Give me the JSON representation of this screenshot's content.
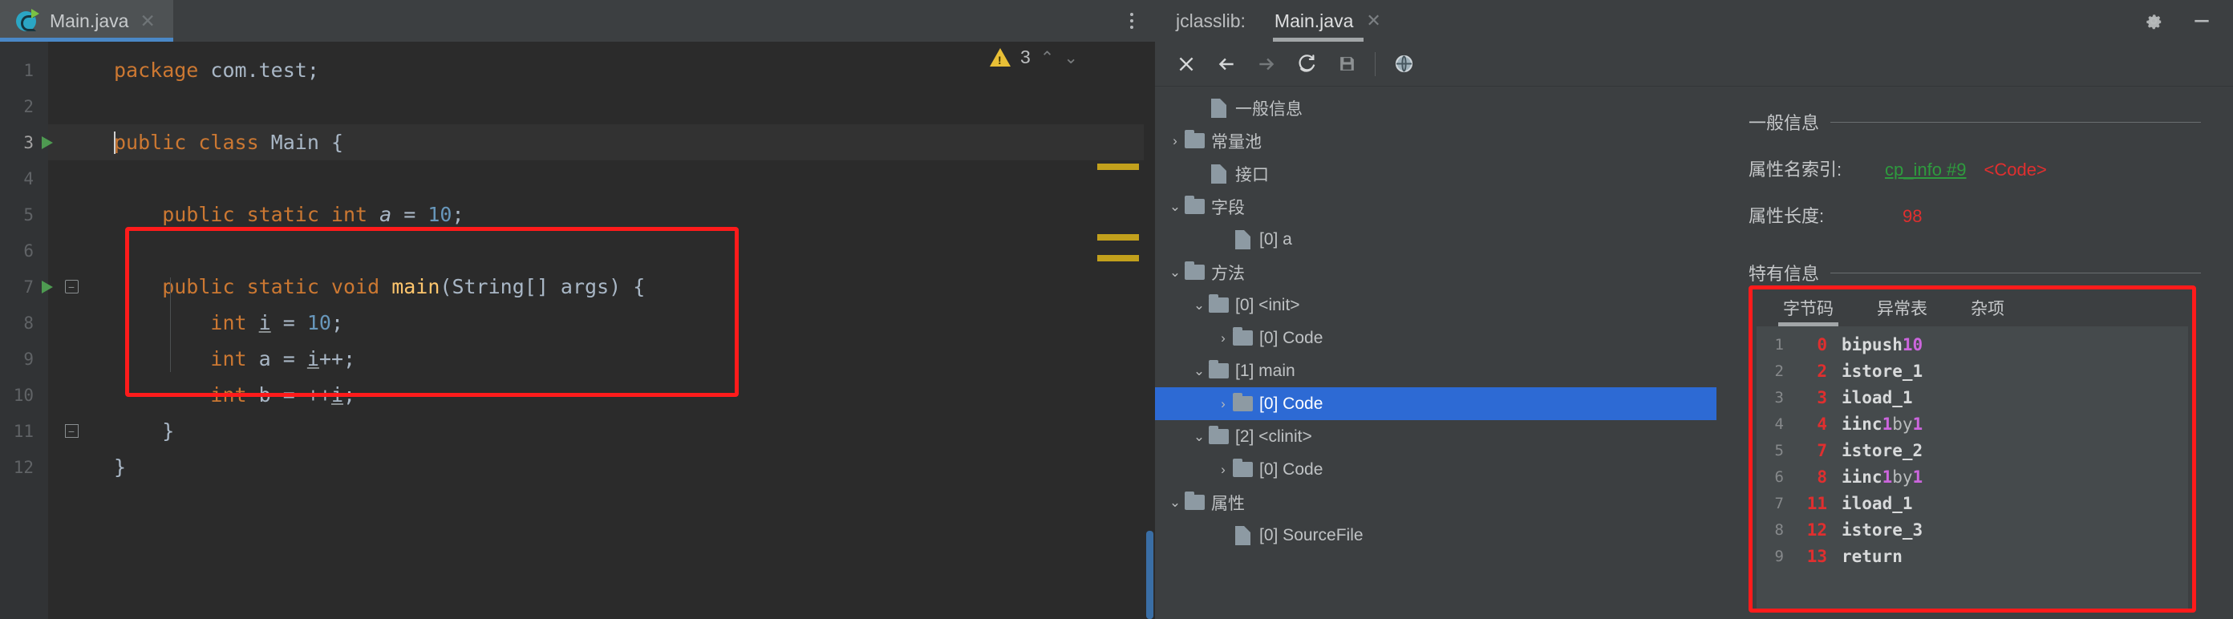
{
  "editor": {
    "tab": {
      "label": "Main.java",
      "icon": "java-class-icon",
      "close": "✕"
    },
    "more_menu": "more-options",
    "inspections": {
      "warning_count": "3",
      "prev": "⌃",
      "next": "⌄"
    },
    "lines": [
      {
        "no": "1",
        "segments": [
          {
            "t": "package ",
            "c": "kw"
          },
          {
            "t": "com.test;",
            "c": "plain"
          }
        ]
      },
      {
        "no": "2",
        "segments": []
      },
      {
        "no": "3",
        "segments": [
          {
            "t": "public class ",
            "c": "kw"
          },
          {
            "t": "Main",
            "c": "plain"
          },
          {
            "t": " {",
            "c": "plain"
          }
        ],
        "run": true,
        "current": true
      },
      {
        "no": "4",
        "segments": []
      },
      {
        "no": "5",
        "segments": [
          {
            "t": "    public static int ",
            "c": "kw"
          },
          {
            "t": "a",
            "c": "ital"
          },
          {
            "t": " = ",
            "c": "plain"
          },
          {
            "t": "10",
            "c": "num"
          },
          {
            "t": ";",
            "c": "plain"
          }
        ]
      },
      {
        "no": "6",
        "segments": []
      },
      {
        "no": "7",
        "segments": [
          {
            "t": "    public static void ",
            "c": "kw"
          },
          {
            "t": "main",
            "c": "fn"
          },
          {
            "t": "(String[] args) {",
            "c": "plain"
          }
        ],
        "run": true,
        "fold": "start"
      },
      {
        "no": "8",
        "segments": [
          {
            "t": "        ",
            "c": "plain"
          },
          {
            "t": "int ",
            "c": "kw"
          },
          {
            "t": "i",
            "c": "u"
          },
          {
            "t": " = ",
            "c": "plain"
          },
          {
            "t": "10",
            "c": "num"
          },
          {
            "t": ";",
            "c": "plain"
          }
        ]
      },
      {
        "no": "9",
        "segments": [
          {
            "t": "        ",
            "c": "plain"
          },
          {
            "t": "int ",
            "c": "kw"
          },
          {
            "t": "a",
            "c": "plain"
          },
          {
            "t": " = ",
            "c": "plain"
          },
          {
            "t": "i",
            "c": "u"
          },
          {
            "t": "++;",
            "c": "plain"
          }
        ]
      },
      {
        "no": "10",
        "segments": [
          {
            "t": "        ",
            "c": "plain"
          },
          {
            "t": "int ",
            "c": "kw"
          },
          {
            "t": "b",
            "c": "plain"
          },
          {
            "t": " = ++",
            "c": "plain"
          },
          {
            "t": "i",
            "c": "u"
          },
          {
            "t": ";",
            "c": "plain"
          }
        ]
      },
      {
        "no": "11",
        "segments": [
          {
            "t": "    }",
            "c": "plain"
          }
        ],
        "fold": "end"
      },
      {
        "no": "12",
        "segments": [
          {
            "t": "}",
            "c": "plain"
          }
        ]
      }
    ],
    "error_stripes_y": [
      152,
      240,
      266
    ],
    "highlight_box": {
      "label": "main-method-highlight"
    }
  },
  "tool_window": {
    "title": "jclasslib:",
    "tab": {
      "label": "Main.java",
      "close": "✕"
    },
    "header_actions": [
      {
        "name": "settings-icon",
        "glyph": "gear"
      },
      {
        "name": "minimize-icon",
        "glyph": "minus"
      }
    ],
    "toolbar": [
      {
        "name": "close-button",
        "glyph": "close"
      },
      {
        "name": "back-button",
        "glyph": "arrow-left"
      },
      {
        "name": "forward-button",
        "glyph": "arrow-right"
      },
      {
        "name": "reload-button",
        "glyph": "refresh"
      },
      {
        "name": "save-button",
        "glyph": "floppy"
      },
      {
        "name": "browse-web-button",
        "glyph": "globe"
      }
    ],
    "tree": [
      {
        "label": "一般信息",
        "indent": 1,
        "twist": "",
        "icon": "doc",
        "selected": false
      },
      {
        "label": "常量池",
        "indent": 0,
        "twist": "›",
        "icon": "folder",
        "selected": false
      },
      {
        "label": "接口",
        "indent": 1,
        "twist": "",
        "icon": "doc",
        "selected": false
      },
      {
        "label": "字段",
        "indent": 0,
        "twist": "⌄",
        "icon": "folder",
        "selected": false
      },
      {
        "label": "[0] a",
        "indent": 2,
        "twist": "",
        "icon": "doc",
        "selected": false
      },
      {
        "label": "方法",
        "indent": 0,
        "twist": "⌄",
        "icon": "folder",
        "selected": false
      },
      {
        "label": "[0] <init>",
        "indent": 1,
        "twist": "⌄",
        "icon": "folder",
        "selected": false
      },
      {
        "label": "[0] Code",
        "indent": 2,
        "twist": "›",
        "icon": "folder",
        "selected": false
      },
      {
        "label": "[1] main",
        "indent": 1,
        "twist": "⌄",
        "icon": "folder",
        "selected": false
      },
      {
        "label": "[0] Code",
        "indent": 2,
        "twist": "›",
        "icon": "folder",
        "selected": true
      },
      {
        "label": "[2] <clinit>",
        "indent": 1,
        "twist": "⌄",
        "icon": "folder",
        "selected": false
      },
      {
        "label": "[0] Code",
        "indent": 2,
        "twist": "›",
        "icon": "folder",
        "selected": false
      },
      {
        "label": "属性",
        "indent": 0,
        "twist": "⌄",
        "icon": "folder",
        "selected": false
      },
      {
        "label": "[0] SourceFile",
        "indent": 2,
        "twist": "",
        "icon": "doc",
        "selected": false
      }
    ],
    "detail": {
      "general_section": "一般信息",
      "rows": [
        {
          "key": "属性名索引:",
          "link": "cp_info #9",
          "value": "<Code>"
        },
        {
          "key": "属性长度:",
          "link": "",
          "value": "98"
        }
      ],
      "specific_section": "特有信息",
      "bytecode_tabs": [
        {
          "label": "字节码",
          "active": true
        },
        {
          "label": "异常表",
          "active": false
        },
        {
          "label": "杂项",
          "active": false
        }
      ],
      "bytecode": [
        {
          "n": "1",
          "offset": "0",
          "mnemonic": "bipush",
          "arg": "10",
          "by": "",
          "arg2": ""
        },
        {
          "n": "2",
          "offset": "2",
          "mnemonic": "istore_1",
          "arg": "",
          "by": "",
          "arg2": ""
        },
        {
          "n": "3",
          "offset": "3",
          "mnemonic": "iload_1",
          "arg": "",
          "by": "",
          "arg2": ""
        },
        {
          "n": "4",
          "offset": "4",
          "mnemonic": "iinc",
          "arg": "1",
          "by": "by",
          "arg2": "1"
        },
        {
          "n": "5",
          "offset": "7",
          "mnemonic": "istore_2",
          "arg": "",
          "by": "",
          "arg2": ""
        },
        {
          "n": "6",
          "offset": "8",
          "mnemonic": "iinc",
          "arg": "1",
          "by": "by",
          "arg2": "1"
        },
        {
          "n": "7",
          "offset": "11",
          "mnemonic": "iload_1",
          "arg": "",
          "by": "",
          "arg2": ""
        },
        {
          "n": "8",
          "offset": "12",
          "mnemonic": "istore_3",
          "arg": "",
          "by": "",
          "arg2": ""
        },
        {
          "n": "9",
          "offset": "13",
          "mnemonic": "return",
          "arg": "",
          "by": "",
          "arg2": ""
        }
      ]
    }
  },
  "colors": {
    "editor_bg": "#2b2b2b",
    "panel_bg": "#3c3f41",
    "tab_active_underline": "#4a88c7",
    "selection_blue": "#2d6ad4",
    "keyword_orange": "#cc7832",
    "number_blue": "#6897bb",
    "method_yellow": "#ffc66d",
    "highlight_red": "#ff1b1b",
    "warning_yellow": "#e8bf36",
    "link_green": "#2e9b3e",
    "value_red": "#e02f2f",
    "arg_purple": "#cc66dd"
  }
}
